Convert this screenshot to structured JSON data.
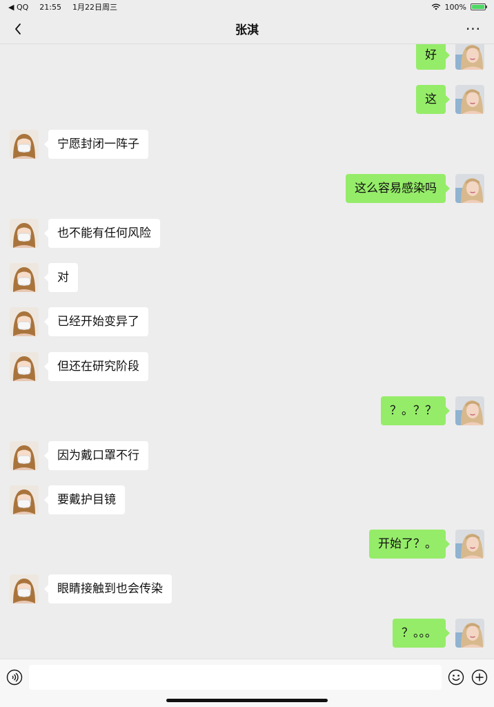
{
  "status_bar": {
    "carrier": "◀ QQ",
    "time": "21:55",
    "date": "1月22日周三",
    "battery": "100%",
    "battery_level": 1.0,
    "icons": [
      "wifi-icon",
      "battery-icon"
    ]
  },
  "nav": {
    "title": "张淇",
    "back_icon": "chevron-left-icon",
    "more_icon": "more-dots-icon",
    "more_label": "···"
  },
  "colors": {
    "background": "#ededed",
    "incoming_bubble": "#ffffff",
    "outgoing_bubble": "#95ec69"
  },
  "messages": [
    {
      "side": "out",
      "text": "好"
    },
    {
      "side": "out",
      "text": "这"
    },
    {
      "side": "in",
      "text": "宁愿封闭一阵子"
    },
    {
      "side": "out",
      "text": "这么容易感染吗"
    },
    {
      "side": "in",
      "text": "也不能有任何风险"
    },
    {
      "side": "in",
      "text": "对"
    },
    {
      "side": "in",
      "text": "已经开始变异了"
    },
    {
      "side": "in",
      "text": "但还在研究阶段"
    },
    {
      "side": "out",
      "text": "？。？？"
    },
    {
      "side": "in",
      "text": "因为戴口罩不行"
    },
    {
      "side": "in",
      "text": "要戴护目镜"
    },
    {
      "side": "out",
      "text": "开始了？。"
    },
    {
      "side": "in",
      "text": "眼睛接触到也会传染"
    },
    {
      "side": "out",
      "text": "？。。。"
    }
  ],
  "input_bar": {
    "value": "",
    "placeholder": "",
    "voice_icon": "voice-icon",
    "emoji_icon": "emoji-icon",
    "plus_icon": "plus-icon"
  }
}
